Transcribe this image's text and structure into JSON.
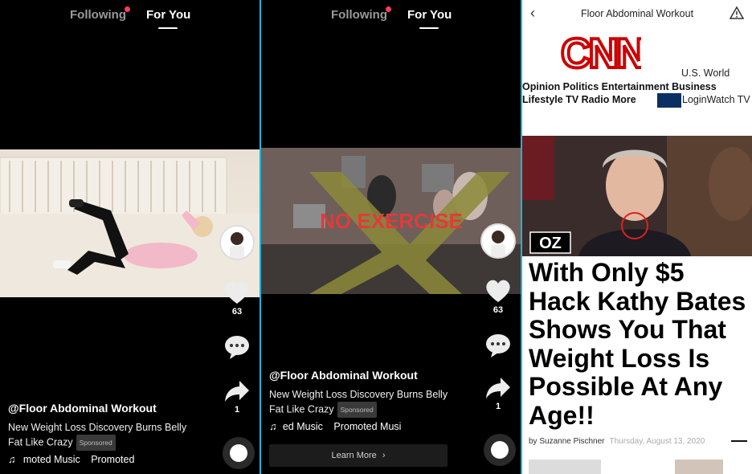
{
  "panel1": {
    "nav": {
      "following": "Following",
      "for_you": "For You"
    },
    "handle": "@Floor Abdominal Workout",
    "desc_line1": "New Weight Loss Discovery Burns Belly",
    "desc_line2": "Fat Like Crazy",
    "sponsored": "Sponsored",
    "music_text": "moted Music",
    "music_text2": "Promoted",
    "like_count": "63",
    "share_count": "1"
  },
  "panel2": {
    "nav": {
      "following": "Following",
      "for_you": "For You"
    },
    "overlay_text": "NO EXERCISE",
    "handle": "@Floor Abdominal Workout",
    "desc_line1": "New Weight Loss Discovery Burns Belly",
    "desc_line2": "Fat Like Crazy",
    "sponsored": "Sponsored",
    "music_text": "ed Music",
    "music_text2": "Promoted Musi",
    "like_count": "63",
    "share_count": "1",
    "learn_more": "Learn More"
  },
  "panel3": {
    "header_title": "Floor Abdominal Workout",
    "logo_text": "CNN",
    "nav_line1_right": "U.S. World",
    "nav_line2": "Opinion Politics Entertainment Business",
    "nav_line3": "Lifestyle TV Radio More",
    "nav_line3_right": "LoginWatch TV",
    "show_badge": "OZ",
    "headline": "With Only $5 Hack Kathy Bates Shows You That Weight Loss Is Possible At Any Age!!",
    "byline": "by Suzanne Pischner",
    "date": "Thursday, August 13, 2020"
  },
  "colors": {
    "accent_divider": "#1fb4d8",
    "notify_dot": "#ff3b5c",
    "cnn_red": "#cc0000"
  }
}
